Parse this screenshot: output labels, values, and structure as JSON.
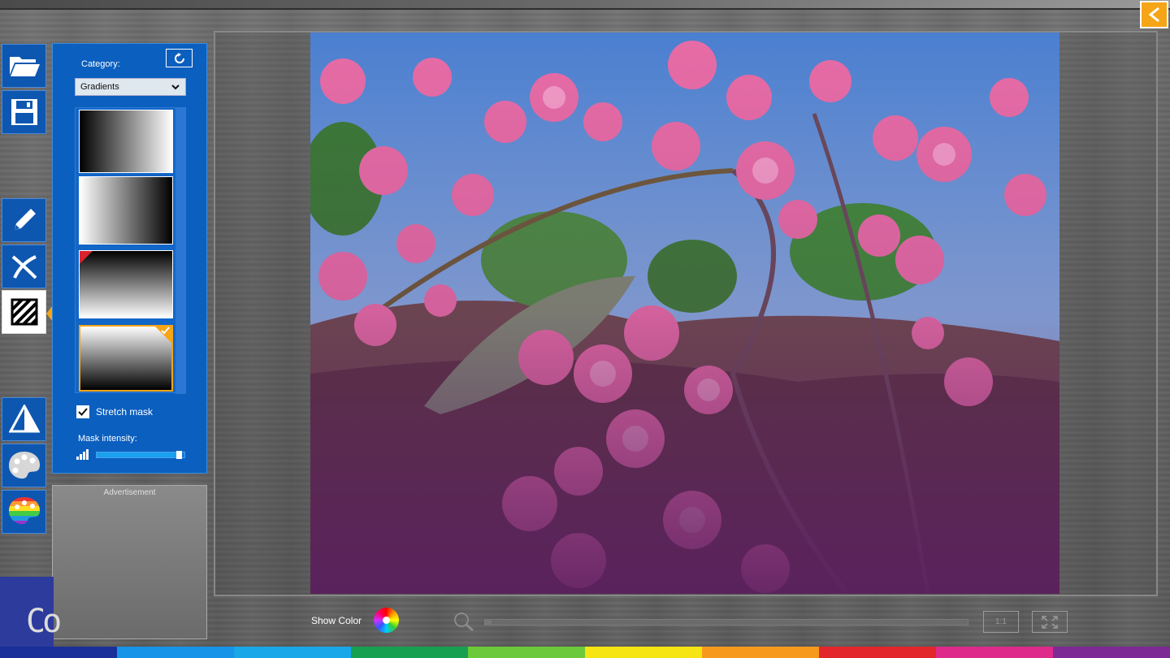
{
  "panel": {
    "category_label": "Category:",
    "category_value": "Gradients",
    "stretch_mask_label": "Stretch mask",
    "stretch_mask_checked": true,
    "mask_intensity_label": "Mask intensity:",
    "mask_intensity": 0.97,
    "selected_gradient_index": 4
  },
  "toolbar": {
    "items": [
      {
        "name": "open",
        "icon": "folder-open-icon"
      },
      {
        "name": "save",
        "icon": "floppy-disk-icon"
      },
      {
        "name": "draw",
        "icon": "pencil-icon"
      },
      {
        "name": "erase",
        "icon": "erase-x-icon"
      },
      {
        "name": "mask",
        "icon": "hatch-mask-icon",
        "active": true
      },
      {
        "name": "adjust",
        "icon": "triangle-icon"
      },
      {
        "name": "palette",
        "icon": "palette-icon"
      },
      {
        "name": "colorize",
        "icon": "rainbow-palette-icon"
      }
    ]
  },
  "ad": {
    "label": "Advertisement"
  },
  "logo": {
    "text": "Co"
  },
  "bottom_bar": {
    "show_color_label": "Show Color",
    "one_to_one_label": "1:1",
    "zoom_level": 0.0
  },
  "colors": {
    "accent": "#f5a516",
    "panel_blue": "#0b5fbf",
    "overlay_purple": "#5a2060"
  }
}
